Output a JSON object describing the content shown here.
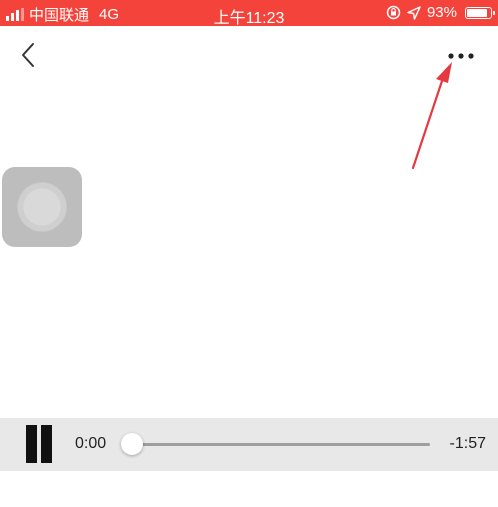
{
  "status_bar": {
    "carrier": "中国联通",
    "network": "4G",
    "time": "上午11:23",
    "battery": "93%",
    "background_color": "#f4433b"
  },
  "nav": {
    "back_icon": "chevron-left-icon",
    "more_icon": "more-horizontal-icon"
  },
  "player": {
    "elapsed": "0:00",
    "remaining": "-1:57",
    "progress": 0,
    "play_state_icon": "pause-icon"
  },
  "annotation": {
    "arrow_color": "#e5393f"
  }
}
